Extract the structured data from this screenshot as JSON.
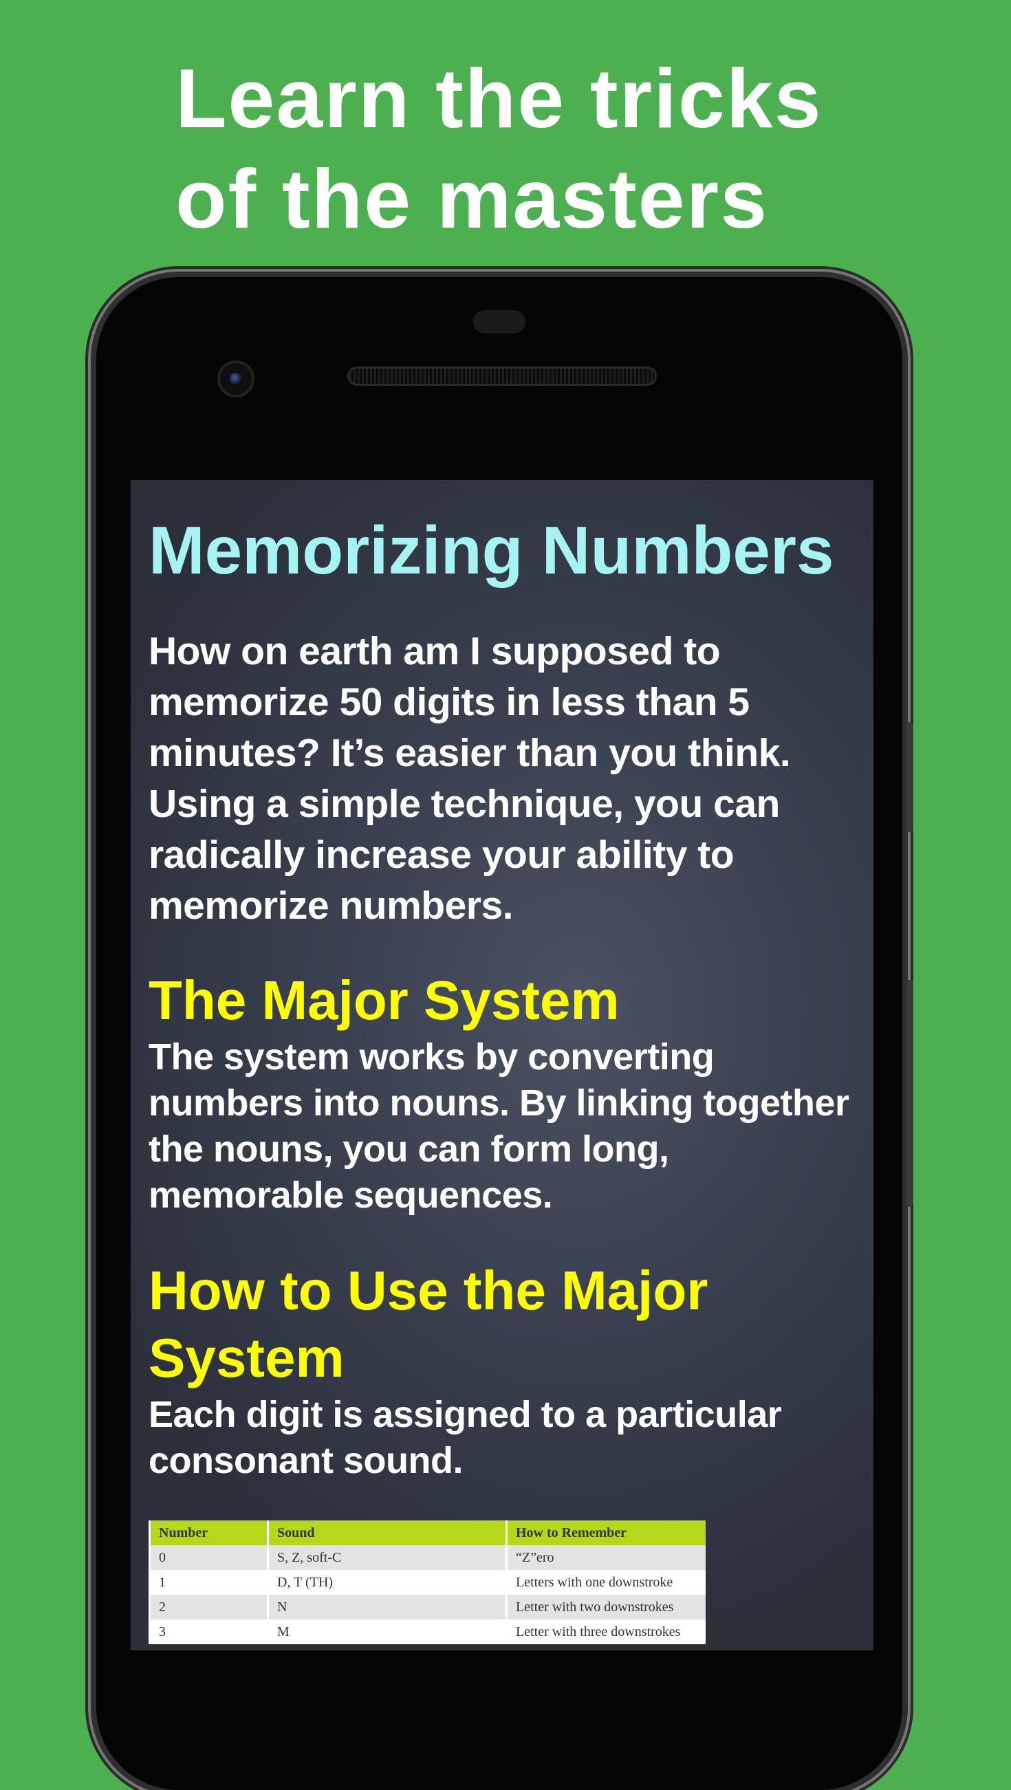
{
  "promo": {
    "line1": "Learn the tricks",
    "line2": "of the masters"
  },
  "article": {
    "title": "Memorizing Numbers",
    "intro": "How on earth am I supposed to memorize 50 digits in less than 5 minutes? It’s easier than you think. Using a simple technique, you can radically increase your ability to memorize numbers.",
    "section1_heading": "The Major System",
    "section1_text": "The system works by converting numbers into nouns. By linking together the nouns, you can form long, memorable sequences.",
    "section2_heading": "How to Use the Major System",
    "section2_text": "Each digit is assigned to a particular consonant sound."
  },
  "table": {
    "headers": [
      "Number",
      "Sound",
      "How to Remember"
    ],
    "rows": [
      [
        "0",
        "S, Z, soft-C",
        "“Z”ero"
      ],
      [
        "1",
        "D, T (TH)",
        "Letters with one downstroke"
      ],
      [
        "2",
        "N",
        "Letter with two downstrokes"
      ],
      [
        "3",
        "M",
        "Letter with three downstrokes"
      ]
    ]
  },
  "colors": {
    "background": "#4caf50",
    "title": "#a6f3f4",
    "heading": "#ffff00",
    "table_header": "#b5d91a"
  }
}
